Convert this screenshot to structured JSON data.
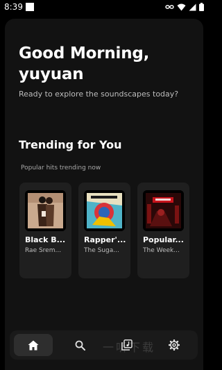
{
  "status_bar": {
    "time": "8:39",
    "icons": [
      "link-icon",
      "wifi-icon",
      "signal-icon",
      "battery-icon"
    ]
  },
  "greeting": {
    "line1": "Good Morning,",
    "line2": "yuyuan",
    "subtitle": "Ready to explore the soundscapes today?"
  },
  "trending": {
    "title": "Trending for You",
    "subtitle": "Popular hits trending now",
    "cards": [
      {
        "title": "Black B...",
        "artist": "Rae Srem..."
      },
      {
        "title": "Rapper'...",
        "artist": "The Suga..."
      },
      {
        "title": "Popular...",
        "artist": "The Week..."
      }
    ]
  },
  "nav": {
    "items": [
      {
        "icon": "home-icon",
        "active": true
      },
      {
        "icon": "search-icon",
        "active": false
      },
      {
        "icon": "library-icon",
        "active": false
      },
      {
        "icon": "gear-icon",
        "active": false
      }
    ]
  },
  "watermark": "一听下载",
  "colors": {
    "background": "#000000",
    "screen": "#121212",
    "card": "#1f1f1f",
    "active_tab": "#2e2e2e",
    "subtitle": "#bdbdbd"
  }
}
